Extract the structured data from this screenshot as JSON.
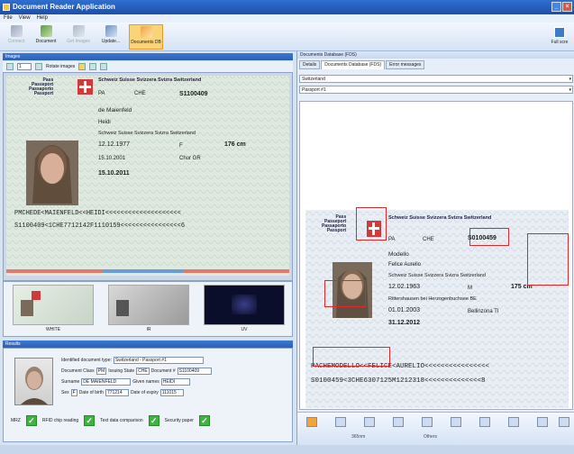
{
  "window": {
    "title": "Document Reader Application"
  },
  "menu": [
    "File",
    "View",
    "Help"
  ],
  "ribbon": {
    "buttons": [
      {
        "label": "Connect",
        "state": "disabled"
      },
      {
        "label": "Document",
        "state": "normal"
      },
      {
        "label": "Get Images",
        "state": "disabled"
      },
      {
        "label": "Update...",
        "state": "normal"
      },
      {
        "label": "Documents DB",
        "state": "active"
      }
    ],
    "right_button": "Full scre"
  },
  "images_panel": {
    "header": "Images",
    "page_value": "1",
    "rotate_label": "Rotate images",
    "thumbnails": [
      "WHITE",
      "IR",
      "UV"
    ]
  },
  "doc_left": {
    "labels": [
      "Pass",
      "Passeport",
      "Passaporto",
      "Passport"
    ],
    "country_header": "Schweiz Suisse Svizzera Svizra Switzerland",
    "type": "PA",
    "code": "CHE",
    "number": "S1100409",
    "surname": "de Maienfeld",
    "given": "Heidi",
    "nationality": "Schweiz Suisse Svizzera Svizra Switzerland",
    "dob": "12.12.1977",
    "sex": "F",
    "height": "176 cm",
    "pob": "Chur GR",
    "issued": "15.10.2001",
    "expiry": "15.10.2011",
    "mrz1": "PMCHEDE<MAIENFELD<<HEIDI<<<<<<<<<<<<<<<<<<<<",
    "mrz2": "S1100409<1CHE7712142F1110159<<<<<<<<<<<<<<<<6"
  },
  "results_panel": {
    "header": "Results",
    "identified_label": "Identified document type:",
    "identified_value": "Switzerland - Passport #1",
    "doc_class_label": "Document Class",
    "doc_class_value": "PM",
    "issuing_label": "Issuing State",
    "issuing_value": "CHE",
    "doc_num_label": "Document #",
    "doc_num_value": "S1100409",
    "surname_label": "Surname",
    "surname_value": "DE MAIENFELD",
    "given_label": "Given names",
    "given_value": "HEIDI",
    "sex_label": "Sex",
    "sex_value": "F",
    "dob_label": "Date of birth",
    "dob_value": "771214",
    "expiry_label": "Date of expiry",
    "expiry_value": "111015",
    "checks": [
      "MRZ",
      "RFID chip reading",
      "Text data comparison",
      "Security paper"
    ]
  },
  "right_panel": {
    "header": "Documents Database (FDS)",
    "tabs": [
      "Details",
      "Documents Database (FDS)",
      "Error messages"
    ],
    "country_select": "Switzerland",
    "doc_select": "Passport #1",
    "doc_right": {
      "labels": [
        "Pass",
        "Passeport",
        "Passaporto",
        "Passport"
      ],
      "country_header": "Schweiz Suisse Svizzera Svizra Switzerland",
      "type": "PA",
      "code": "CHE",
      "number": "S0100459",
      "surname": "Modello",
      "given": "Felice Aurelio",
      "nationality": "Schweiz Suisse Svizzera Svizra Switzerland",
      "dob": "12.02.1963",
      "sex": "M",
      "height": "175 cm",
      "pob": "Rittershausen bei Herzogenbuchsee BE",
      "issued": "01.01.2003",
      "authority": "Bellinzona TI",
      "expiry": "31.12.2012",
      "mrz1": "PACHEMODELLO<<FELICE<AURELIO<<<<<<<<<<<<<<<<",
      "mrz2": "S0100459<3CHE6307125M1212318<<<<<<<<<<<<<<8"
    },
    "bottom_labels": [
      "365nm",
      "Others"
    ]
  },
  "status": {
    "text": ""
  },
  "colors": {
    "accent": "#2a5fb6",
    "red_box": "#e02828",
    "check_green": "#3fb33f"
  }
}
